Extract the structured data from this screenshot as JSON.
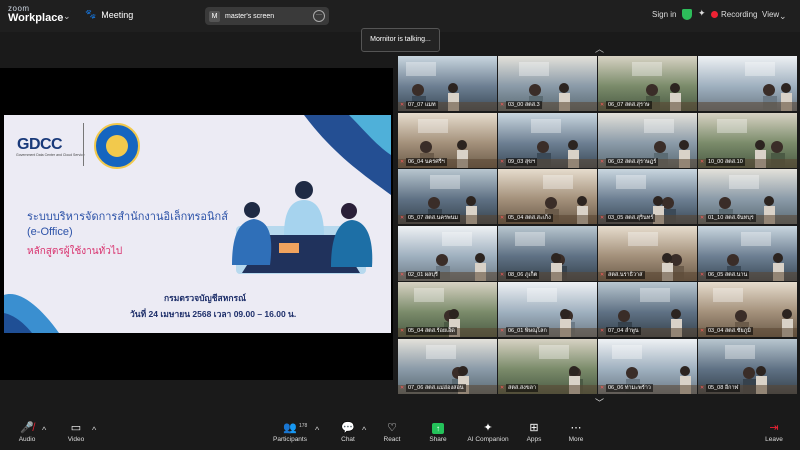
{
  "app": {
    "brand_top": "zoom",
    "brand_bottom": "Workplace"
  },
  "header": {
    "meeting_label": "Meeting",
    "screen_pill": "master's screen",
    "screen_initial": "M",
    "signin": "Sign in",
    "recording": "Recording",
    "view": "View"
  },
  "tooltip": "Mornitor is talking...",
  "slide": {
    "org_logo": "GDCC",
    "org_sub": "Government Data Center and Cloud Service",
    "title_line1": "ระบบบริหารจัดการสำนักงานอิเล็กทรอนิกส์",
    "title_line2": "(e-Office)",
    "subtitle": "หลักสูตรผู้ใช้งานทั่วไป",
    "department": "กรมตรวจบัญชีสหกรณ์",
    "date_line": "วันที่ 24 เมษายน 2568 เวลา 09.00 – 16.00 น."
  },
  "participants": [
    "07_07 แมท",
    "03_00 สตส.3",
    "06_07 สตส.สุราษ",
    "",
    "06_04 นครศรีฯ",
    "09_03 สุขฯ",
    "06_02 สตส.สุราษฎร์",
    "10_00 สตส.10",
    "05_07 สตส.นครพนม",
    "05_04 สตส.สะเก็ง",
    "03_05 สตส.สุรินทร์",
    "01_10 สตส.จันทบุร",
    "02_01 ผลบุรี",
    "08_06 ภูเก็ต",
    "สตส.นราธิวาส",
    "06_05 สตส.นาน",
    "05_04 สตส.ร้อยเอ็ด",
    "06_01 พิษณุโลก",
    "07_04 ลำพูน",
    "03_04 สตส.ชัยภูมิ",
    "07_06 สตส.แม่ฮ่องสอน",
    "สตส.สงขลา",
    "06_06 ท่ามะพร้าว",
    "05_08 อีกาฬ"
  ],
  "toolbar": {
    "audio": "Audio",
    "video": "Video",
    "participants": "Participants",
    "participants_count": "178",
    "chat": "Chat",
    "react": "React",
    "share": "Share",
    "ai": "AI Companion",
    "apps": "Apps",
    "more": "More",
    "leave": "Leave"
  },
  "colors": {
    "recording": "#e22233",
    "share": "#24c25a",
    "secure": "#2dbd5a",
    "leave": "#e22233"
  }
}
